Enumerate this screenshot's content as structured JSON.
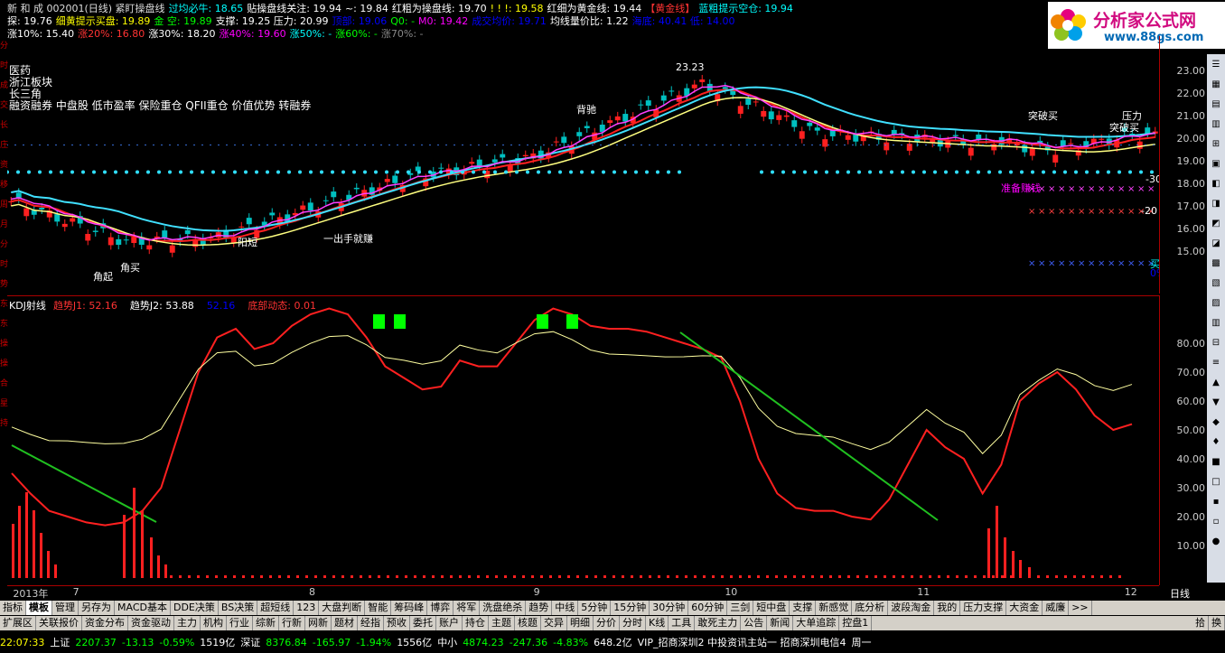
{
  "header": {
    "row1": [
      {
        "t": "新 和 成 002001(日线) 紧盯操盘线",
        "c": "#ddd"
      },
      {
        "t": "过均必牛: 18.65",
        "c": "#0ff"
      },
      {
        "t": "贴操盘线关注: 19.94",
        "c": "#fff"
      },
      {
        "t": "~: 19.84",
        "c": "#fff"
      },
      {
        "t": "红粗为操盘线: 19.70",
        "c": "#fff"
      },
      {
        "t": "! ! !: 19.58",
        "c": "#ff0"
      },
      {
        "t": "红细为黄金线: 19.44",
        "c": "#fff"
      },
      {
        "t": "【黄金线】",
        "c": "#f33"
      },
      {
        "t": "蓝粗提示空仓: 19.94",
        "c": "#0ff"
      }
    ],
    "row2": [
      {
        "t": "探: 19.76",
        "c": "#fff"
      },
      {
        "t": "细黄提示买盘: 19.89",
        "c": "#ff0"
      },
      {
        "t": "金 空: 19.89",
        "c": "#0f0"
      },
      {
        "t": "支撑: 19.25 压力: 20.99",
        "c": "#fff"
      },
      {
        "t": "顶部: 19.06",
        "c": "#00f"
      },
      {
        "t": "Q0: -",
        "c": "#0f0"
      },
      {
        "t": "M0: 19.42",
        "c": "#f0f"
      },
      {
        "t": "成交均价: 19.71",
        "c": "#00f"
      },
      {
        "t": "均线量价比: 1.22",
        "c": "#fff"
      },
      {
        "t": "海底: 40.41 低: 14.00",
        "c": "#00f"
      }
    ],
    "row3": [
      {
        "t": "涨10%: 15.40",
        "c": "#fff"
      },
      {
        "t": "涨20%: 16.80",
        "c": "#f33"
      },
      {
        "t": "涨30%: 18.20",
        "c": "#fff"
      },
      {
        "t": "涨40%: 19.60",
        "c": "#f0f"
      },
      {
        "t": "涨50%: -",
        "c": "#0ff"
      },
      {
        "t": "涨60%: -",
        "c": "#0f0"
      },
      {
        "t": "涨70%: -",
        "c": "#888"
      }
    ]
  },
  "logo": {
    "title": "分析家公式网",
    "url": "www.88gs.com"
  },
  "stock_tags": [
    "医药",
    "浙江板块",
    "长三角",
    "融资融券 中盘股 低市盈率 保险重仓 QFII重仓 价值优势 转融券"
  ],
  "annotations": [
    {
      "t": "23.23",
      "c": "#fff"
    },
    {
      "t": "突破买",
      "c": "#fff"
    },
    {
      "t": "压力",
      "c": "#fff"
    },
    {
      "t": "突破买",
      "c": "#fff"
    },
    {
      "t": "准备赚钱",
      "c": "#f0f"
    },
    {
      "t": "角买",
      "c": "#fff"
    },
    {
      "t": "角起",
      "c": "#fff"
    },
    {
      "t": "背驰",
      "c": "#fff"
    },
    {
      "t": "阳短",
      "c": "#fff"
    },
    {
      "t": "一出手就赚",
      "c": "#fff"
    },
    {
      "t": "-30",
      "c": "#fff"
    },
    {
      "t": "-20",
      "c": "#fff"
    },
    {
      "t": "买",
      "c": "#0ff"
    },
    {
      "t": "0%",
      "c": "#00f"
    }
  ],
  "price_axis": [
    "23.00",
    "22.00",
    "21.00",
    "20.00",
    "19.00",
    "18.00",
    "17.00",
    "16.00",
    "15.00"
  ],
  "kdj": {
    "title": "KDJ射线",
    "items": [
      {
        "t": "趋势J1: 52.16",
        "c": "#f33"
      },
      {
        "t": "趋势J2: 53.88",
        "c": "#fff"
      },
      {
        "t": "52.16",
        "c": "#00f"
      },
      {
        "t": "底部动态: 0.01",
        "c": "#f33"
      }
    ],
    "axis": [
      "80.00",
      "70.00",
      "60.00",
      "50.00",
      "40.00",
      "30.00",
      "20.00",
      "10.00"
    ]
  },
  "left_strip": [
    "分",
    "时",
    "成",
    "交",
    "长",
    "庄",
    "资",
    "移",
    "周",
    "月",
    "分",
    "时"
  ],
  "left_strip_kdj": [
    "势",
    "东",
    "东",
    "操",
    "操",
    "合",
    "星",
    "持"
  ],
  "dates": [
    {
      "t": "2013年",
      "p": 0.005
    },
    {
      "t": "7",
      "p": 0.057
    },
    {
      "t": "8",
      "p": 0.262
    },
    {
      "t": "9",
      "p": 0.457
    },
    {
      "t": "10",
      "p": 0.623
    },
    {
      "t": "11",
      "p": 0.79
    },
    {
      "t": "12",
      "p": 0.97
    }
  ],
  "date_label": "日线",
  "tabs1": [
    "指标",
    "模板",
    "管理",
    "另存为",
    "MACD基本",
    "DDE决策",
    "BS决策",
    "超短线",
    "123",
    "大盘判断",
    "智能",
    "筹码峰",
    "博弈",
    "将军",
    "洗盘绝杀",
    "趋势",
    "中线",
    "5分钟",
    "15分钟",
    "30分钟",
    "60分钟",
    "三剑",
    "短中盘",
    "支撑",
    "新感觉",
    "底分析",
    "波段淘金",
    "我的",
    "压力支撑",
    "大资金",
    "威廉",
    ">>"
  ],
  "tabs1_active": 1,
  "tabs2": [
    "扩展区",
    "关联报价",
    "资金分布",
    "资金驱动",
    "主力",
    "机构",
    "行业",
    "综新",
    "行新",
    "网新",
    "题材",
    "经指",
    "预收",
    "委托",
    "账户",
    "持仓",
    "主题",
    "核题",
    "交异",
    "明细",
    "分价",
    "分时",
    "K线",
    "工具",
    "敢死主力",
    "公告",
    "新闻",
    "大单追踪",
    "控盘1"
  ],
  "tabs2_right": [
    "拾",
    "换"
  ],
  "status": [
    {
      "t": "22:07:33",
      "c": "#ff0"
    },
    {
      "t": "上证",
      "c": "#fff"
    },
    {
      "t": "2207.37",
      "c": "#0f0"
    },
    {
      "t": "-13.13",
      "c": "#0f0"
    },
    {
      "t": "-0.59%",
      "c": "#0f0"
    },
    {
      "t": "1519亿",
      "c": "#fff"
    },
    {
      "t": "深证",
      "c": "#fff"
    },
    {
      "t": "8376.84",
      "c": "#0f0"
    },
    {
      "t": "-165.97",
      "c": "#0f0"
    },
    {
      "t": "-1.94%",
      "c": "#0f0"
    },
    {
      "t": "1556亿",
      "c": "#fff"
    },
    {
      "t": "中小",
      "c": "#fff"
    },
    {
      "t": "4874.23",
      "c": "#0f0"
    },
    {
      "t": "-247.36",
      "c": "#0f0"
    },
    {
      "t": "-4.83%",
      "c": "#0f0"
    },
    {
      "t": "648.2亿",
      "c": "#fff"
    },
    {
      "t": "VIP_招商深圳2 中投资讯主站一 招商深圳电信4",
      "c": "#fff"
    },
    {
      "t": "周一",
      "c": "#fff"
    }
  ],
  "colors": {
    "up": "#ff2020",
    "down": "#00c0c0",
    "bg": "#000000",
    "grid": "#aa0000"
  }
}
